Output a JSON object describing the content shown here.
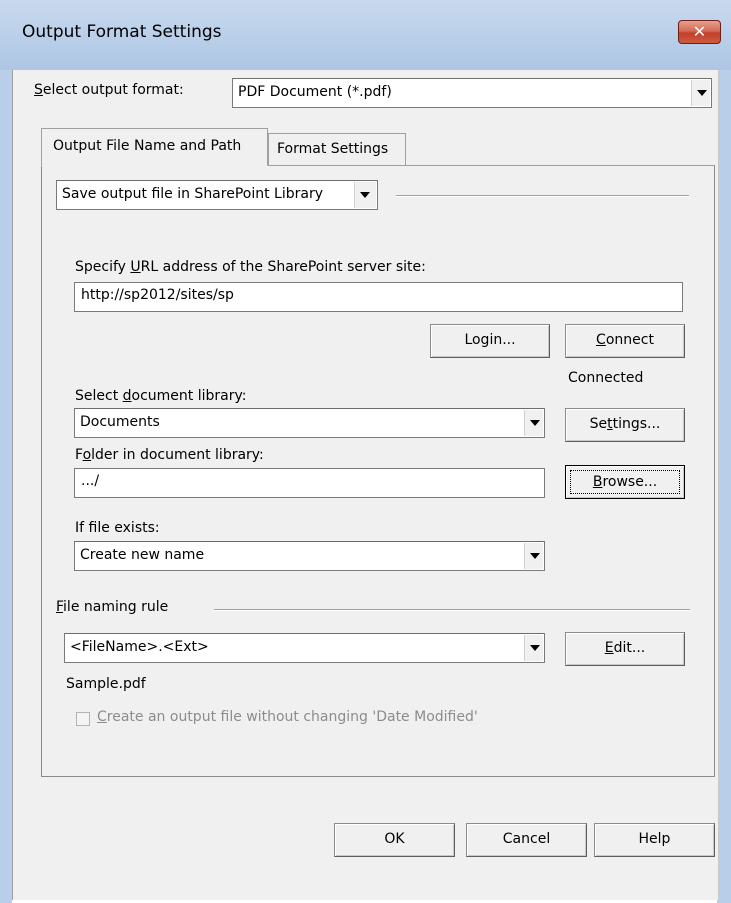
{
  "window": {
    "title": "Output Format Settings",
    "close_glyph": "✕"
  },
  "output_format": {
    "label": "Select output format:",
    "value": "PDF Document (*.pdf)"
  },
  "tabs": [
    {
      "label": "Output File Name and Path",
      "active": true
    },
    {
      "label": "Format Settings",
      "active": false
    }
  ],
  "save_mode": {
    "value": "Save output file in SharePoint Library"
  },
  "url": {
    "label": "Specify URL address of the SharePoint server site:",
    "value": "http://sp2012/sites/sp"
  },
  "buttons": {
    "login": "Login...",
    "connect": "Connect",
    "settings": "Settings...",
    "browse": "Browse...",
    "edit": "Edit...",
    "ok": "OK",
    "cancel": "Cancel",
    "help": "Help"
  },
  "status": {
    "connected": "Connected"
  },
  "library": {
    "label": "Select document library:",
    "value": "Documents"
  },
  "folder": {
    "label": "Folder in document library:",
    "value": ".../"
  },
  "file_exists": {
    "label": "If file exists:",
    "value": "Create new name"
  },
  "naming": {
    "label": "File naming rule",
    "value": "<FileName>.<Ext>",
    "sample": "Sample.pdf"
  },
  "keep_date": {
    "label": "Create an output file without changing 'Date Modified'",
    "checked": false,
    "enabled": false
  },
  "colors": {
    "title_bar": "#b9cfe9",
    "close_button": "#c2402a",
    "dialog_bg": "#f0f0f0"
  }
}
